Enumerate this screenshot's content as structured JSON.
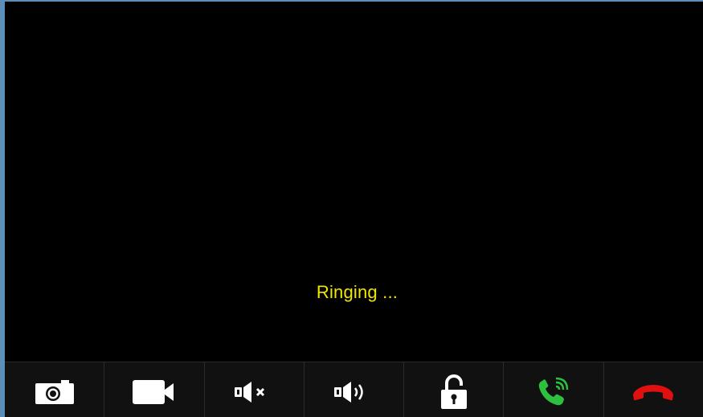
{
  "call": {
    "status_text": "Ringing ..."
  },
  "toolbar": {
    "buttons": [
      {
        "name": "snapshot-button",
        "icon": "camera-icon"
      },
      {
        "name": "record-button",
        "icon": "video-camera-icon"
      },
      {
        "name": "mute-button",
        "icon": "speaker-mute-icon"
      },
      {
        "name": "volume-button",
        "icon": "speaker-on-icon"
      },
      {
        "name": "unlock-button",
        "icon": "unlock-icon"
      },
      {
        "name": "answer-button",
        "icon": "phone-answer-icon"
      },
      {
        "name": "hangup-button",
        "icon": "phone-hangup-icon"
      }
    ]
  },
  "colors": {
    "status_text": "#f2e600",
    "answer": "#2fbf3f",
    "hangup": "#e01010",
    "icon": "#ffffff"
  }
}
